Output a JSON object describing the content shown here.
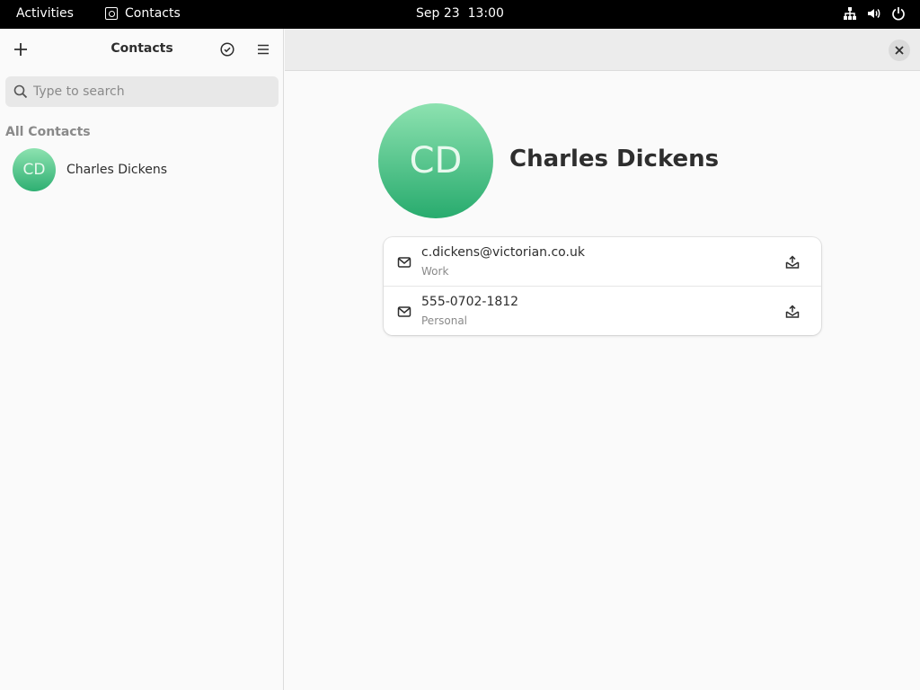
{
  "topbar": {
    "activities": "Activities",
    "app_name": "Contacts",
    "clock": "Sep 23  13:00",
    "tray_icons": [
      "network-icon",
      "volume-icon",
      "power-icon"
    ]
  },
  "sidebar": {
    "title": "Contacts",
    "search_placeholder": "Type to search",
    "section_label": "All Contacts",
    "contacts": [
      {
        "initials": "CD",
        "name": "Charles Dickens"
      }
    ]
  },
  "detail": {
    "initials": "CD",
    "name": "Charles Dickens",
    "fields": [
      {
        "icon": "mail-icon",
        "value": "c.dickens@victorian.co.uk",
        "type": "Work"
      },
      {
        "icon": "mail-icon",
        "value": "555-0702-1812",
        "type": "Personal"
      }
    ]
  },
  "colors": {
    "avatar_top": "#8de2b0",
    "avatar_bottom": "#2eaf72",
    "topbar": "#000000"
  }
}
